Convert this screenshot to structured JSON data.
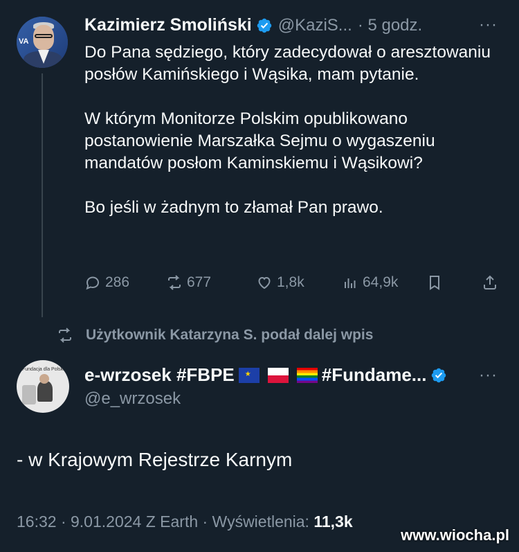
{
  "tweet1": {
    "author_name": "Kazimierz Smoliński",
    "handle": "@KaziS...",
    "time": "· 5 godz.",
    "more": "···",
    "paragraphs": [
      "Do Pana sędziego, który zadecydował o aresztowaniu posłów Kamińskiego i Wąsika, mam pytanie.",
      "W którym Monitorze Polskim opublikowano postanowienie Marszałka Sejmu o wygaszeniu mandatów posłom Kaminskiemu i Wąsikowi?",
      "Bo jeśli w żadnym to złamał Pan prawo."
    ],
    "stats": {
      "replies": "286",
      "reposts": "677",
      "likes": "1,8k",
      "views": "64,9k"
    }
  },
  "repost_notice": "Użytkownik Katarzyna S. podał dalej wpis",
  "tweet2": {
    "author_name_prefix": "e-wrzosek #FBPE",
    "author_name_suffix": "#Fundame...",
    "handle": "@e_wrzosek",
    "more": "···",
    "avatar_text": "Fundacja dla Polski",
    "body": "- w Krajowym Rejestrze Karnym",
    "meta_prefix": "16:32 · 9.01.2024 Z Earth · Wyświetlenia: ",
    "views": "11,3k"
  },
  "watermark": "www.wiocha.pl",
  "colors": {
    "background": "#15202b",
    "text": "#f7f9f9",
    "secondary": "#8b98a5",
    "verified": "#1d9bf0"
  }
}
